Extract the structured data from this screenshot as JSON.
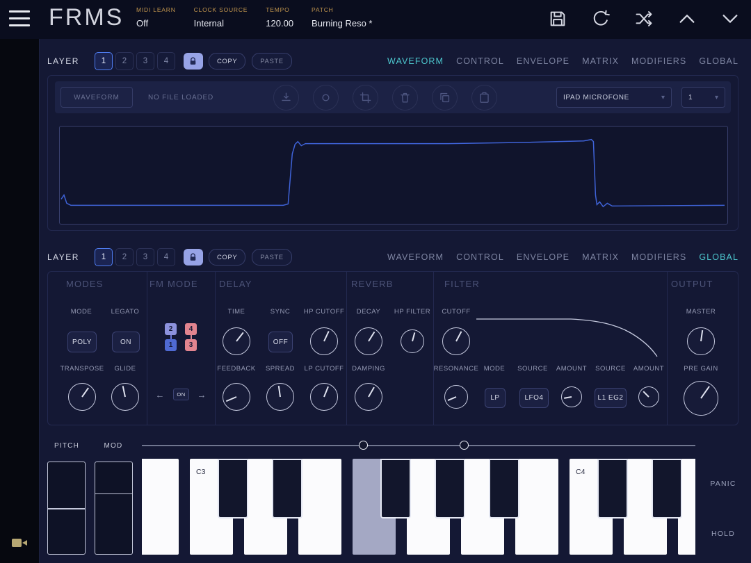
{
  "topbar": {
    "logo": "FRMS",
    "fields": [
      {
        "label": "MIDI LEARN",
        "value": "Off"
      },
      {
        "label": "CLOCK SOURCE",
        "value": "Internal"
      },
      {
        "label": "TEMPO",
        "value": "120.00"
      },
      {
        "label": "PATCH",
        "value": "Burning Reso *"
      }
    ]
  },
  "tabs": {
    "labels": [
      "WAVEFORM",
      "CONTROL",
      "ENVELOPE",
      "MATRIX",
      "MODIFIERS",
      "GLOBAL"
    ]
  },
  "layer_header": {
    "label": "LAYER",
    "layers": [
      "1",
      "2",
      "3",
      "4"
    ],
    "copy": "COPY",
    "paste": "PASTE"
  },
  "section1": {
    "active_tab": "WAVEFORM",
    "toolbar": {
      "waveform_button": "WAVEFORM",
      "file_status": "NO FILE LOADED",
      "input_select": "IPAD MICROFONE",
      "channel_select": "1"
    }
  },
  "section2": {
    "active_tab": "GLOBAL",
    "modes": {
      "title": "MODES",
      "mode_label": "MODE",
      "mode_value": "POLY",
      "legato_label": "LEGATO",
      "legato_value": "ON",
      "transpose_label": "TRANSPOSE",
      "glide_label": "GLIDE"
    },
    "fm_mode": {
      "title": "FM MODE",
      "on_label": "ON",
      "operators": [
        {
          "num": "2"
        },
        {
          "num": "4"
        },
        {
          "num": "1"
        },
        {
          "num": "3"
        }
      ]
    },
    "delay": {
      "title": "DELAY",
      "time_label": "TIME",
      "sync_label": "SYNC",
      "sync_value": "OFF",
      "hp_cutoff_label": "HP CUTOFF",
      "feedback_label": "FEEDBACK",
      "spread_label": "SPREAD",
      "lp_cutoff_label": "LP CUTOFF"
    },
    "reverb": {
      "title": "REVERB",
      "decay_label": "DECAY",
      "hp_filter_label": "HP FILTER",
      "damping_label": "DAMPING"
    },
    "filter": {
      "title": "FILTER",
      "cutoff_label": "CUTOFF",
      "resonance_label": "RESONANCE",
      "mode_label": "MODE",
      "mode_value": "LP",
      "source1_label": "SOURCE",
      "source1_value": "LFO4",
      "amount1_label": "AMOUNT",
      "source2_label": "SOURCE",
      "source2_value": "L1 EG2",
      "amount2_label": "AMOUNT"
    },
    "output": {
      "title": "OUTPUT",
      "master_label": "MASTER",
      "pre_gain_label": "PRE GAIN"
    }
  },
  "knobs": {
    "transpose": 35,
    "glide": -12,
    "time": 38,
    "hp_cutoff": 25,
    "feedback": -113,
    "spread": -8,
    "lp_cutoff": 22,
    "decay": 32,
    "hp_filter": 15,
    "damping": 30,
    "cutoff": 28,
    "resonance": -113,
    "amount1": -100,
    "amount2": -45,
    "master": 8,
    "pre_gain": 35
  },
  "bottom": {
    "pitch_label": "PITCH",
    "mod_label": "MOD",
    "panic": "PANIC",
    "hold": "HOLD",
    "key_labels": {
      "c3": "C3",
      "c4": "C4"
    }
  },
  "colors": {
    "accent": "#4dc6cd",
    "active_border": "#4f7df0",
    "op_blue": "#4f6ad2",
    "op_purple": "#8d92dd",
    "op_pink": "#e2848f",
    "waveform_line": "#3f63d8"
  }
}
